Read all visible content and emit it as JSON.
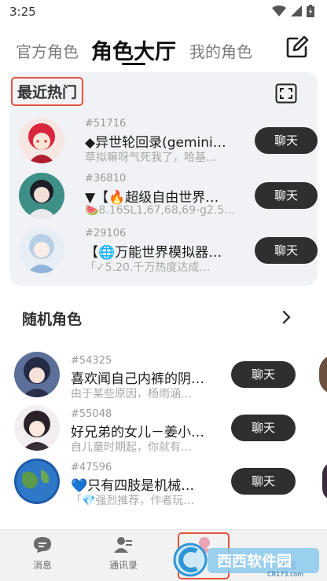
{
  "status": {
    "time": "3:25"
  },
  "tabs": [
    {
      "label": "官方角色"
    },
    {
      "label": "角色大厅"
    },
    {
      "label": "我的角色"
    }
  ],
  "hot": {
    "title": "最近热门",
    "items": [
      {
        "id": "#51716",
        "name": "◆异世轮回录(gemini…",
        "desc": "草拟嘛呀气死我了，哈基…",
        "button": "聊天"
      },
      {
        "id": "#36810",
        "name": "▼【🔥超级自由世界…",
        "desc": "🍉8.16SL1,67,68,69-g2.5…",
        "button": "聊天"
      },
      {
        "id": "#29106",
        "name": "【🌐万能世界模拟器…",
        "desc": "「✓5.20.千万热度达成…",
        "button": "聊天"
      }
    ]
  },
  "random": {
    "title": "随机角色",
    "items": [
      {
        "id": "#54325",
        "name": "喜欢闻自己内裤的阴…",
        "desc": "由于某些原因，杨雨涵…",
        "button": "聊天"
      },
      {
        "id": "#55048",
        "name": "好兄弟的女儿－姜小…",
        "desc": "自儿童时期起，你就有…",
        "button": "聊天"
      },
      {
        "id": "#47596",
        "name": "💙只有四肢是机械…",
        "desc": "「💎强烈推荐，作者玩…",
        "button": "聊天"
      }
    ]
  },
  "nav": [
    {
      "label": "消息"
    },
    {
      "label": "通讯录"
    },
    {
      "label": ""
    },
    {
      "label": "消息"
    }
  ],
  "watermark": {
    "brand": "西西软件园",
    "url": "CR173.com"
  },
  "colors": {
    "highlight": "#e2553f",
    "button": "#2f2f2f",
    "card": "#f1f2f5"
  }
}
